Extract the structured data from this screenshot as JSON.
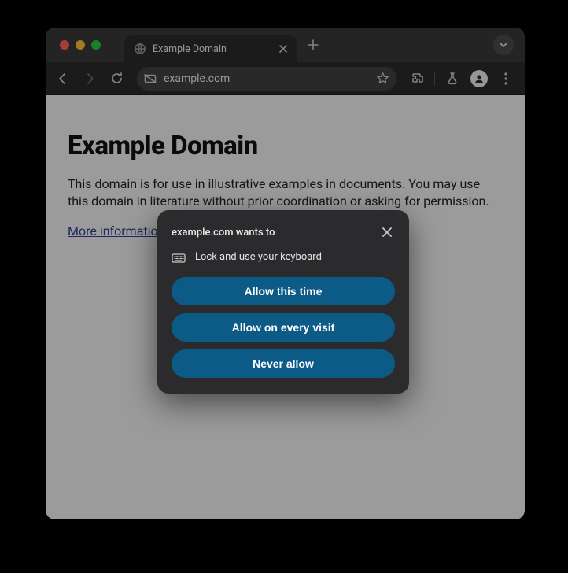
{
  "tab": {
    "title": "Example Domain"
  },
  "toolbar": {
    "url": "example.com"
  },
  "page": {
    "heading": "Example Domain",
    "body": "This domain is for use in illustrative examples in documents. You may use this domain in literature without prior coordination or asking for permission.",
    "link_label": "More information..."
  },
  "dialog": {
    "title": "example.com wants to",
    "permission_label": "Lock and use your keyboard",
    "allow_once_label": "Allow this time",
    "allow_always_label": "Allow on every visit",
    "never_label": "Never allow"
  },
  "colors": {
    "accent": "#0c5a86"
  }
}
